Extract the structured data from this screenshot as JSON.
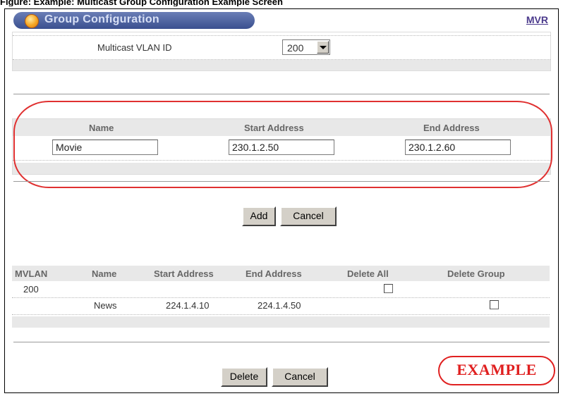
{
  "caption": "Figure: Example: Multicast Group Configuration Example Screen",
  "header": {
    "title": "Group Configuration",
    "mvr_link": "MVR"
  },
  "vlan": {
    "label": "Multicast VLAN ID",
    "selected": "200"
  },
  "group_form": {
    "headers": {
      "name": "Name",
      "start": "Start Address",
      "end": "End Address"
    },
    "values": {
      "name": "Movie",
      "start": "230.1.2.50",
      "end": "230.1.2.60"
    }
  },
  "form_buttons": {
    "add": "Add",
    "cancel": "Cancel"
  },
  "table": {
    "headers": [
      "MVLAN",
      "Name",
      "Start Address",
      "End Address",
      "Delete All",
      "Delete Group"
    ],
    "rows": [
      {
        "mvlan": "200",
        "name": "",
        "start": "",
        "end": ""
      },
      {
        "mvlan": "",
        "name": "News",
        "start": "224.1.4.10",
        "end": "224.1.4.50"
      }
    ]
  },
  "table_buttons": {
    "delete": "Delete",
    "cancel": "Cancel"
  },
  "stamp": "EXAMPLE",
  "colors": {
    "title_bar": "#3a4f8f",
    "highlight": "#e03030",
    "panel_band": "#e8e8e8"
  }
}
